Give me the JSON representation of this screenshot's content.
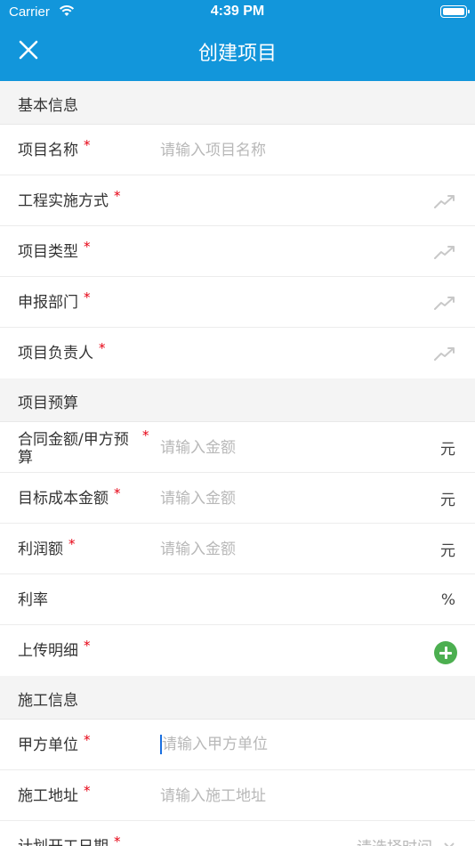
{
  "status_bar": {
    "carrier": "Carrier",
    "time": "4:39 PM"
  },
  "nav": {
    "title": "创建项目"
  },
  "sections": {
    "basic": {
      "title": "基本信息",
      "project_name": {
        "label": "项目名称",
        "required": "*",
        "placeholder": "请输入项目名称"
      },
      "implementation": {
        "label": "工程实施方式",
        "required": "*"
      },
      "project_type": {
        "label": "项目类型",
        "required": "*"
      },
      "department": {
        "label": "申报部门",
        "required": "*"
      },
      "manager": {
        "label": "项目负责人",
        "required": "*"
      }
    },
    "budget": {
      "title": "项目预算",
      "contract_amount": {
        "label": "合同金额/甲方预算",
        "required": "*",
        "placeholder": "请输入金额",
        "unit": "元"
      },
      "target_cost": {
        "label": "目标成本金额",
        "required": "*",
        "placeholder": "请输入金额",
        "unit": "元"
      },
      "profit": {
        "label": "利润额",
        "required": "*",
        "placeholder": "请输入金额",
        "unit": "元"
      },
      "rate": {
        "label": "利率",
        "unit": "%"
      },
      "upload": {
        "label": "上传明细",
        "required": "*"
      }
    },
    "construction": {
      "title": "施工信息",
      "party_a": {
        "label": "甲方单位",
        "required": "*",
        "placeholder": "请输入甲方单位"
      },
      "address": {
        "label": "施工地址",
        "required": "*",
        "placeholder": "请输入施工地址"
      },
      "start_date": {
        "label": "计划开工日期",
        "required": "*",
        "placeholder": "请选择时间"
      }
    }
  },
  "icons": {
    "close": "close-icon",
    "select": "trend-icon",
    "add": "add-icon",
    "accent": "#1296db",
    "required_color": "#e60012",
    "add_color": "#4caf50"
  }
}
